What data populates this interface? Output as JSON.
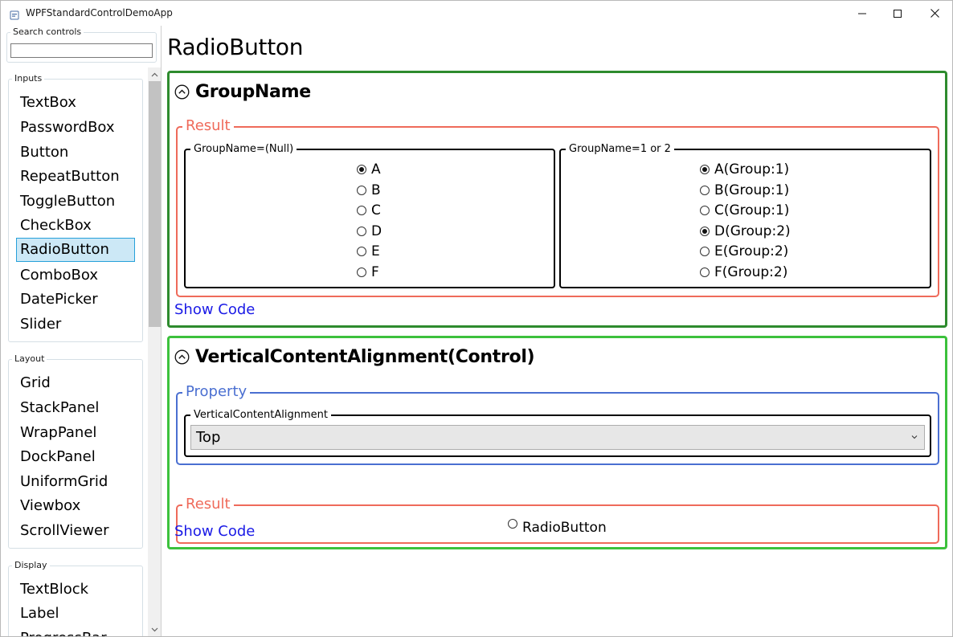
{
  "window": {
    "title": "WPFStandardControlDemoApp"
  },
  "sidebar": {
    "search_label": "Search controls",
    "search_value": "",
    "categories": [
      {
        "name": "Inputs",
        "items": [
          "TextBox",
          "PasswordBox",
          "Button",
          "RepeatButton",
          "ToggleButton",
          "CheckBox",
          "RadioButton",
          "ComboBox",
          "DatePicker",
          "Slider"
        ]
      },
      {
        "name": "Layout",
        "items": [
          "Grid",
          "StackPanel",
          "WrapPanel",
          "DockPanel",
          "UniformGrid",
          "Viewbox",
          "ScrollViewer"
        ]
      },
      {
        "name": "Display",
        "items": [
          "TextBlock",
          "Label",
          "ProgressBar"
        ]
      }
    ],
    "selected_item": "RadioButton"
  },
  "main": {
    "page_title": "RadioButton",
    "groupname_section": {
      "title": "GroupName",
      "result_label": "Result",
      "left_group": {
        "label": "GroupName=(Null)",
        "options": [
          {
            "label": "A",
            "checked": true
          },
          {
            "label": "B",
            "checked": false
          },
          {
            "label": "C",
            "checked": false
          },
          {
            "label": "D",
            "checked": false
          },
          {
            "label": "E",
            "checked": false
          },
          {
            "label": "F",
            "checked": false
          }
        ]
      },
      "right_group": {
        "label": "GroupName=1 or 2",
        "options": [
          {
            "label": "A(Group:1)",
            "checked": true
          },
          {
            "label": "B(Group:1)",
            "checked": false
          },
          {
            "label": "C(Group:1)",
            "checked": false
          },
          {
            "label": "D(Group:2)",
            "checked": true
          },
          {
            "label": "E(Group:2)",
            "checked": false
          },
          {
            "label": "F(Group:2)",
            "checked": false
          }
        ]
      },
      "show_code": "Show Code"
    },
    "vca_section": {
      "title": "VerticalContentAlignment(Control)",
      "property_label": "Property",
      "property_field_label": "VerticalContentAlignment",
      "property_value": "Top",
      "result_label": "Result",
      "result_radio_label": "RadioButton",
      "result_radio_checked": false,
      "show_code": "Show Code"
    }
  },
  "colors": {
    "section_border_1": "#2e8b2e",
    "section_border_2": "#3cc13c",
    "result_border": "#ef6a5a",
    "property_border": "#4a6fd1",
    "link": "#1a1ae6",
    "selection_bg": "#cce8f6",
    "selection_border": "#26a0da"
  }
}
